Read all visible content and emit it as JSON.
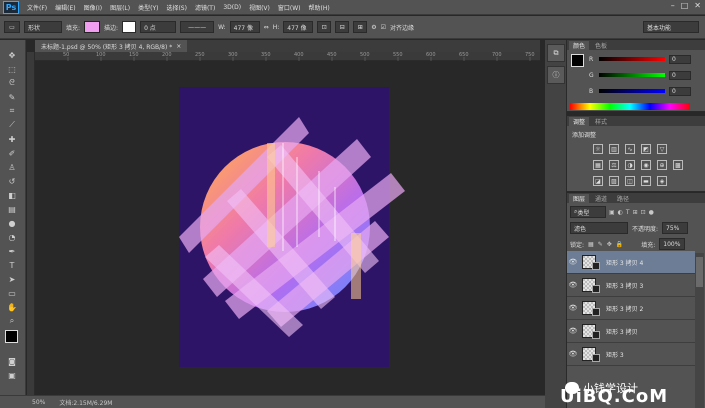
{
  "app": {
    "logo": "Ps",
    "menu": [
      "文件(F)",
      "编辑(E)",
      "图像(I)",
      "图层(L)",
      "类型(Y)",
      "选择(S)",
      "滤镜(T)",
      "3D(D)",
      "视图(V)",
      "窗口(W)",
      "帮助(H)"
    ]
  },
  "options": {
    "shape_mode": "形状",
    "fill_label": "填充:",
    "stroke_label": "描边:",
    "stroke_size": "0 点",
    "w_label": "W:",
    "w_value": "477 像",
    "h_label": "H:",
    "h_value": "477 像",
    "align_edges": "对齐边缘",
    "workspace": "基本功能"
  },
  "document": {
    "tab_title": "未标题-1.psd @ 50% (矩形 3 拷贝 4, RGB/8) *"
  },
  "rulers": {
    "top": [
      "50",
      "100",
      "150",
      "200",
      "250",
      "300",
      "350",
      "400",
      "450",
      "500",
      "550",
      "600",
      "650",
      "700",
      "750"
    ]
  },
  "status": {
    "zoom": "50%",
    "doc_info": "文档:2.15M/6.29M"
  },
  "color_panel": {
    "tabs": [
      "颜色",
      "色板"
    ],
    "rows": [
      {
        "ch": "R",
        "value": "0"
      },
      {
        "ch": "G",
        "value": "0"
      },
      {
        "ch": "B",
        "value": "0"
      }
    ]
  },
  "adjust_panel": {
    "tabs": [
      "调整",
      "样式"
    ],
    "title": "添加调整"
  },
  "layers_panel": {
    "tabs": [
      "图层",
      "通道",
      "路径"
    ],
    "filter": "类型",
    "blend_mode": "滤色",
    "opacity_label": "不透明度:",
    "opacity_value": "75%",
    "lock_label": "锁定:",
    "fill_label": "填充:",
    "fill_value": "100%",
    "layers": [
      {
        "name": "矩形 3 拷贝 4",
        "selected": true
      },
      {
        "name": "矩形 3 拷贝 3",
        "selected": false
      },
      {
        "name": "矩形 3 拷贝 2",
        "selected": false
      },
      {
        "name": "矩形 3 拷贝",
        "selected": false
      },
      {
        "name": "矩形 3",
        "selected": false
      }
    ]
  },
  "watermark": {
    "text": "小钱学设计",
    "site": "UiBQ.CoM"
  },
  "colors": {
    "poster_bg": "#2e1466",
    "fill_swatch": "#f09ef0",
    "selected_layer": "#6c7d95"
  }
}
